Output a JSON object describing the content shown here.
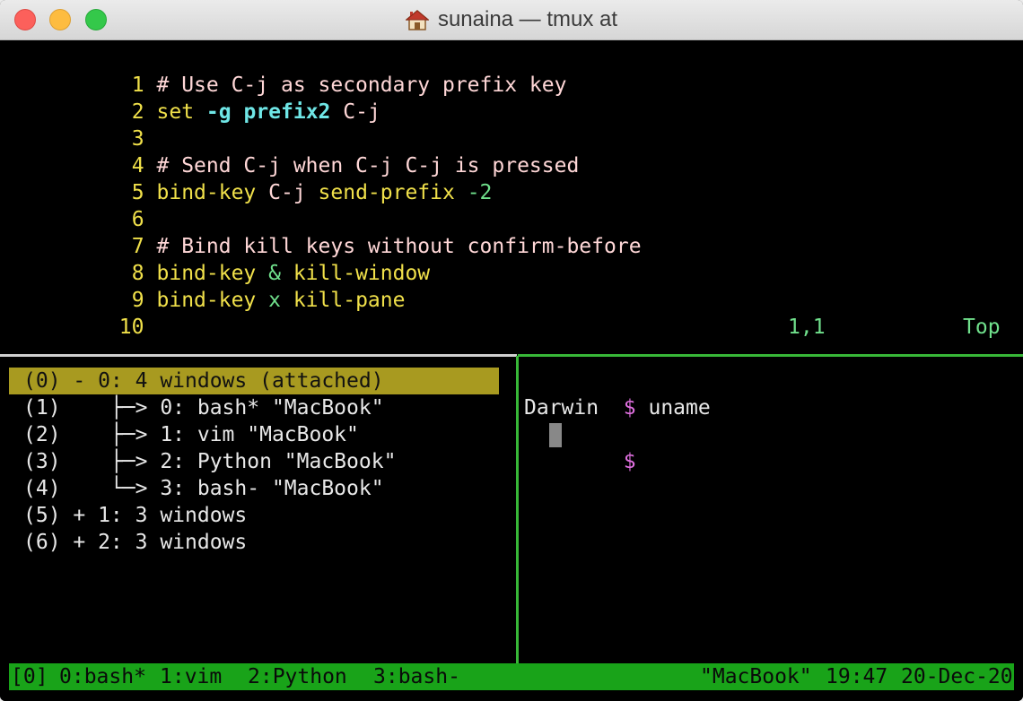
{
  "window": {
    "title": "sunaina — tmux at"
  },
  "editor": {
    "lines": [
      {
        "num": "1",
        "comment": "# Use C-j as secondary prefix key"
      },
      {
        "num": "2",
        "cmd": "set",
        "flag": "-g",
        "opt": "prefix2",
        "rest": " C-j"
      },
      {
        "num": "3"
      },
      {
        "num": "4",
        "comment": "# Send C-j when C-j C-j is pressed"
      },
      {
        "num": "5",
        "cmd": "bind-key",
        "key": " C-j ",
        "action": "send-prefix",
        "arg": " -2"
      },
      {
        "num": "6"
      },
      {
        "num": "7",
        "comment": "# Bind kill keys without confirm-before"
      },
      {
        "num": "8",
        "cmd": "bind-key",
        "key": " & ",
        "action": "kill-window"
      },
      {
        "num": "9",
        "cmd": "bind-key",
        "key": " x ",
        "action": "kill-pane"
      },
      {
        "num": "10"
      }
    ],
    "position": "1,1",
    "scroll": "Top"
  },
  "tree": {
    "selected": "(0) - 0: 4 windows (attached)",
    "items": [
      "(1)    ├─> 0: bash* \"MacBook\"",
      "(2)    ├─> 1: vim \"MacBook\"",
      "(3)    ├─> 2: Python \"MacBook\"",
      "(4)    └─> 3: bash- \"MacBook\"",
      "(5) + 1: 3 windows",
      "(6) + 2: 3 windows"
    ]
  },
  "shell": {
    "prompt": "$",
    "command": " uname",
    "output": "Darwin",
    "prompt2": "$"
  },
  "statusbar": {
    "session": "[0]",
    "windows": [
      {
        "label": "0:bash*"
      },
      {
        "label": "1:vim"
      },
      {
        "label": "2:Python"
      },
      {
        "label": "3:bash-"
      }
    ],
    "host": "\"MacBook\"",
    "time": "19:47",
    "date": "20-Dec-20"
  },
  "colors": {
    "status_bg": "#19a319",
    "selection_bg": "#a89a20",
    "pane_border_active": "#38b838"
  }
}
